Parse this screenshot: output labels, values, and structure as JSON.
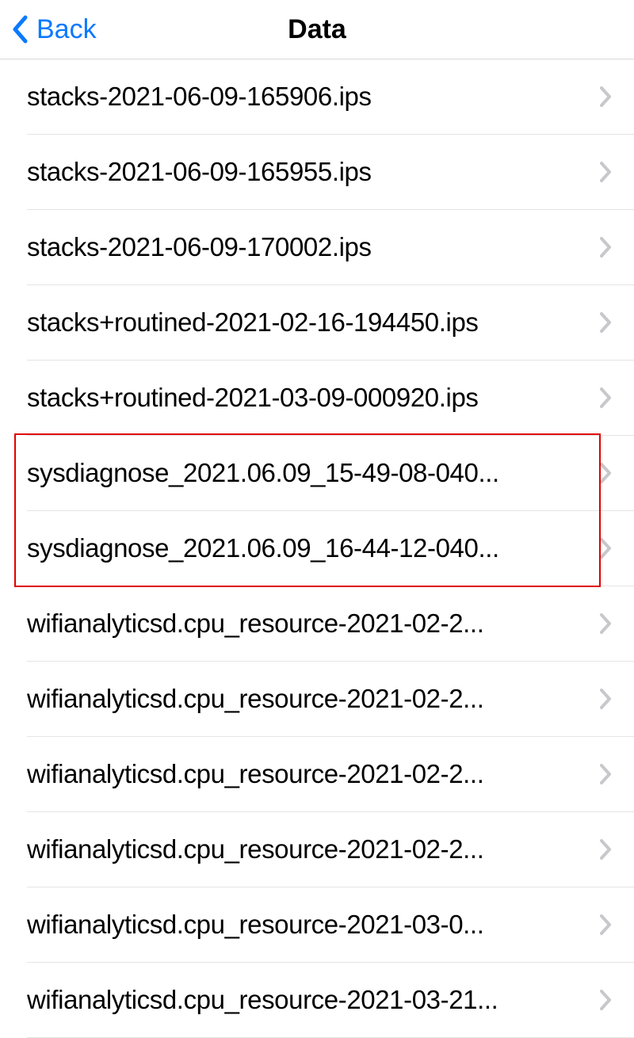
{
  "nav": {
    "back_label": "Back",
    "title": "Data"
  },
  "items": [
    {
      "label": "stacks-2021-06-09-165906.ips"
    },
    {
      "label": "stacks-2021-06-09-165955.ips"
    },
    {
      "label": "stacks-2021-06-09-170002.ips"
    },
    {
      "label": "stacks+routined-2021-02-16-194450.ips"
    },
    {
      "label": "stacks+routined-2021-03-09-000920.ips"
    },
    {
      "label": "sysdiagnose_2021.06.09_15-49-08-040..."
    },
    {
      "label": "sysdiagnose_2021.06.09_16-44-12-040..."
    },
    {
      "label": "wifianalyticsd.cpu_resource-2021-02-2..."
    },
    {
      "label": "wifianalyticsd.cpu_resource-2021-02-2..."
    },
    {
      "label": "wifianalyticsd.cpu_resource-2021-02-2..."
    },
    {
      "label": "wifianalyticsd.cpu_resource-2021-02-2..."
    },
    {
      "label": "wifianalyticsd.cpu_resource-2021-03-0..."
    },
    {
      "label": "wifianalyticsd.cpu_resource-2021-03-21..."
    }
  ],
  "highlight": {
    "start_index": 5,
    "end_index": 6
  }
}
